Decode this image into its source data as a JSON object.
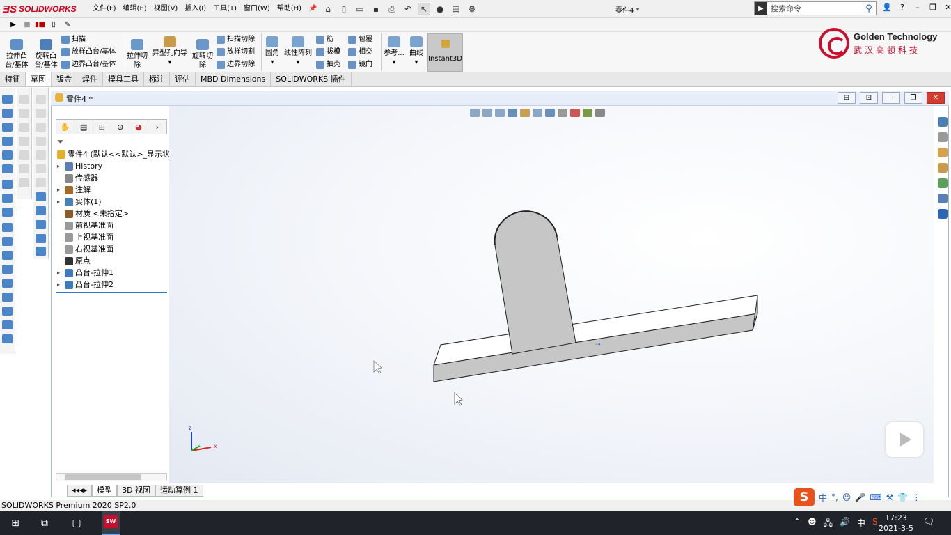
{
  "app": {
    "logo_text": "SOLIDWORKS",
    "doc_title": "零件4 *"
  },
  "menu": [
    "文件(F)",
    "编辑(E)",
    "视图(V)",
    "插入(I)",
    "工具(T)",
    "窗口(W)",
    "帮助(H)"
  ],
  "search": {
    "placeholder": "搜索命令"
  },
  "ribbon": {
    "extrude_boss": "拉伸凸\n台/基体",
    "revolve_boss": "旋转凸\n台/基体",
    "sweep": "扫描",
    "loft_boss": "放样凸台/基体",
    "boundary_boss": "边界凸台/基体",
    "extrude_cut": "拉伸切\n除",
    "hole_wizard": "异型孔向导",
    "revolve_cut": "旋转切\n除",
    "sweep_cut": "扫描切除",
    "loft_cut": "放样切割",
    "boundary_cut": "边界切除",
    "fillet": "圆角",
    "linear_pattern": "线性阵列",
    "rib": "筋",
    "draft": "拔模",
    "shell": "抽壳",
    "wrap": "包覆",
    "intersect": "相交",
    "mirror": "镜向",
    "reference": "参考...",
    "curves": "曲线",
    "instant3d": "Instant3D"
  },
  "brand": {
    "en": "Golden Technology",
    "cn": "武汉高顿科技"
  },
  "tabs": [
    "特征",
    "草图",
    "钣金",
    "焊件",
    "模具工具",
    "标注",
    "评估",
    "MBD Dimensions",
    "SOLIDWORKS 插件"
  ],
  "active_tab": "特征",
  "doc_window": {
    "title": "零件4 *"
  },
  "tree": {
    "root": "零件4  (默认<<默认>_显示状",
    "items": [
      {
        "label": "History",
        "arrow": "▸",
        "color": "#5b7db1"
      },
      {
        "label": "传感器",
        "arrow": "",
        "color": "#888888"
      },
      {
        "label": "注解",
        "arrow": "▸",
        "color": "#a06a2a"
      },
      {
        "label": "实体(1)",
        "arrow": "▸",
        "color": "#4a7fb5"
      },
      {
        "label": "材质 <未指定>",
        "arrow": "",
        "color": "#8a5a2a"
      },
      {
        "label": "前视基准面",
        "arrow": "",
        "color": "#9a9a9a"
      },
      {
        "label": "上视基准面",
        "arrow": "",
        "color": "#9a9a9a"
      },
      {
        "label": "右视基准面",
        "arrow": "",
        "color": "#9a9a9a"
      },
      {
        "label": "原点",
        "arrow": "",
        "color": "#333333"
      },
      {
        "label": "凸台-拉伸1",
        "arrow": "▸",
        "color": "#3f7ac0"
      },
      {
        "label": "凸台-拉伸2",
        "arrow": "▸",
        "color": "#3f7ac0"
      }
    ]
  },
  "bottom_tabs": [
    "模型",
    "3D 视图",
    "运动算例 1"
  ],
  "status": "SOLIDWORKS Premium 2020 SP2.0",
  "ime": {
    "mode": "中"
  },
  "taskbar": {
    "sw_label": "SW",
    "time": "17:23",
    "date": "2021-3-5",
    "tray_lang": "中"
  },
  "axes": {
    "z": "z",
    "x": "x"
  },
  "colors": {
    "accent": "#c8102e",
    "part_face": "#c6c6c6",
    "part_top": "#ffffff"
  }
}
